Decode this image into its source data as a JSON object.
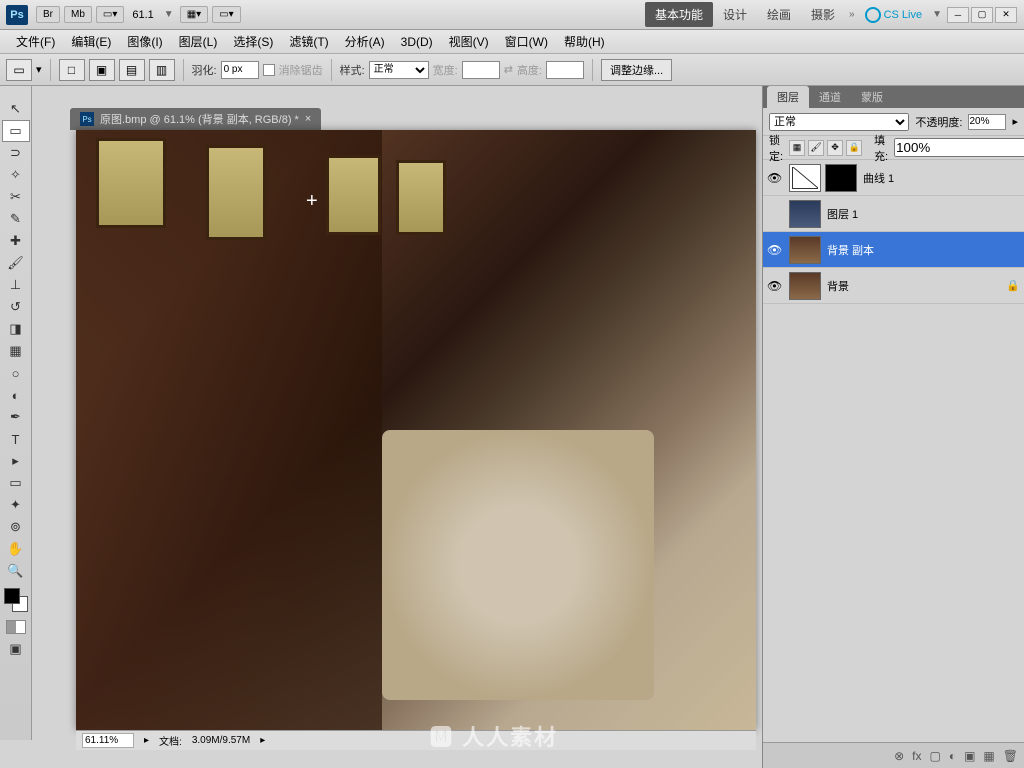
{
  "topbar": {
    "app": "Ps",
    "br": "Br",
    "mb": "Mb",
    "zoom": "61.1",
    "workspaces": {
      "basic": "基本功能",
      "design": "设计",
      "paint": "绘画",
      "photo": "摄影"
    },
    "cslive": "CS Live"
  },
  "menu": {
    "file": "文件(F)",
    "edit": "编辑(E)",
    "image": "图像(I)",
    "layer": "图层(L)",
    "select": "选择(S)",
    "filter": "滤镜(T)",
    "analysis": "分析(A)",
    "td": "3D(D)",
    "view": "视图(V)",
    "window": "窗口(W)",
    "help": "帮助(H)"
  },
  "options": {
    "feather_label": "羽化:",
    "feather_val": "0 px",
    "antialias": "消除锯齿",
    "style_label": "样式:",
    "style_val": "正常",
    "width_label": "宽度:",
    "height_label": "高度:",
    "refine": "调整边缘..."
  },
  "doc": {
    "title": "原图.bmp @ 61.1% (背景 副本, RGB/8) *"
  },
  "status": {
    "zoom": "61.11%",
    "doc_label": "文档:",
    "doc_size": "3.09M/9.57M"
  },
  "panels": {
    "tabs": {
      "layers": "图层",
      "channels": "通道",
      "paths": "蒙版"
    },
    "blend": "正常",
    "opacity_label": "不透明度:",
    "opacity_val": "20%",
    "lock_label": "锁定:",
    "fill_label": "填充:",
    "fill_val": "100%"
  },
  "layers": [
    {
      "name": "曲线 1",
      "type": "curves"
    },
    {
      "name": "图层 1",
      "type": "normal"
    },
    {
      "name": "背景 副本",
      "type": "normal",
      "selected": true
    },
    {
      "name": "背景",
      "type": "bg",
      "locked": true
    }
  ],
  "watermark": "人人素材"
}
